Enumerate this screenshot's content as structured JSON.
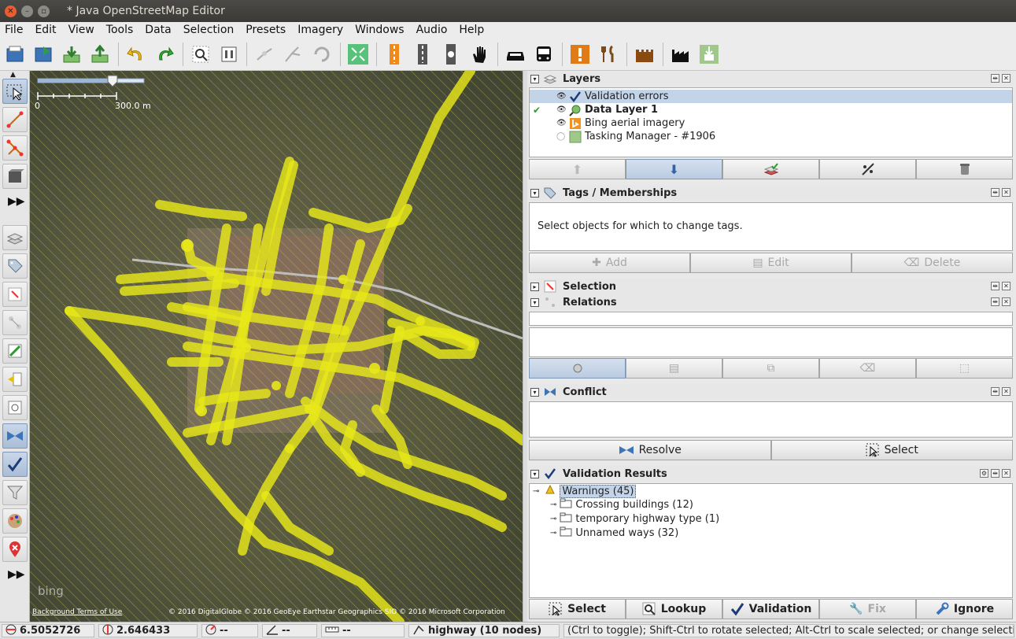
{
  "window": {
    "title": "* Java OpenStreetMap Editor"
  },
  "menu": [
    "File",
    "Edit",
    "View",
    "Tools",
    "Data",
    "Selection",
    "Presets",
    "Imagery",
    "Windows",
    "Audio",
    "Help"
  ],
  "toolbar": {
    "icons": [
      "open-icon",
      "save-icon",
      "download-icon",
      "upload-icon",
      "undo-icon",
      "redo-icon",
      "zoom-icon",
      "preferences-icon",
      "split-way-icon",
      "combine-way-icon",
      "reverse-icon",
      "simplify-icon",
      "highway-preset-icon",
      "road-preset-icon",
      "rail-preset-icon",
      "hand-icon",
      "car-icon",
      "bus-icon",
      "warning-icon",
      "restaurant-icon",
      "castle-icon",
      "factory-icon",
      "tasking-icon"
    ]
  },
  "map": {
    "scale_start": "0",
    "scale_end": "300.0 m",
    "bing_logo": "bing",
    "footer_links": "Background Terms of Use",
    "attribution": "© 2016 DigitalGlobe © 2016 GeoEye Earthstar Geographics  SIO © 2016 Microsoft Corporation"
  },
  "layers": {
    "title": "Layers",
    "items": [
      {
        "name": "Validation errors",
        "selected": true,
        "bold": false,
        "active": false,
        "visible": true
      },
      {
        "name": "Data Layer 1",
        "selected": false,
        "bold": true,
        "active": true,
        "visible": true
      },
      {
        "name": "Bing aerial imagery",
        "selected": false,
        "bold": false,
        "active": false,
        "visible": true
      },
      {
        "name": "Tasking Manager - #1906",
        "selected": false,
        "bold": false,
        "active": false,
        "visible": false
      }
    ]
  },
  "tags": {
    "title": "Tags / Memberships",
    "message": "Select objects for which to change tags.",
    "add_label": "Add",
    "edit_label": "Edit",
    "delete_label": "Delete"
  },
  "selection": {
    "title": "Selection"
  },
  "relations": {
    "title": "Relations"
  },
  "conflict": {
    "title": "Conflict",
    "resolve_label": "Resolve",
    "select_label": "Select"
  },
  "validation": {
    "title": "Validation Results",
    "root": "Warnings (45)",
    "children": [
      "Crossing buildings (12)",
      "temporary highway type (1)",
      "Unnamed ways (32)"
    ],
    "select_label": "Select",
    "lookup_label": "Lookup",
    "validation_label": "Validation",
    "fix_label": "Fix",
    "ignore_label": "Ignore"
  },
  "status": {
    "lat": "6.5052726",
    "lon": "2.646433",
    "heading": "--",
    "angle": "--",
    "distance": "--",
    "selection": "highway (10 nodes)",
    "help": "(Ctrl to toggle); Shift-Ctrl to rotate selected; Alt-Ctrl to scale selected; or change selection"
  },
  "colors": {
    "accent": "#c4d4e8",
    "ways": "#f2f21a",
    "imagery": "#5b5e45"
  }
}
